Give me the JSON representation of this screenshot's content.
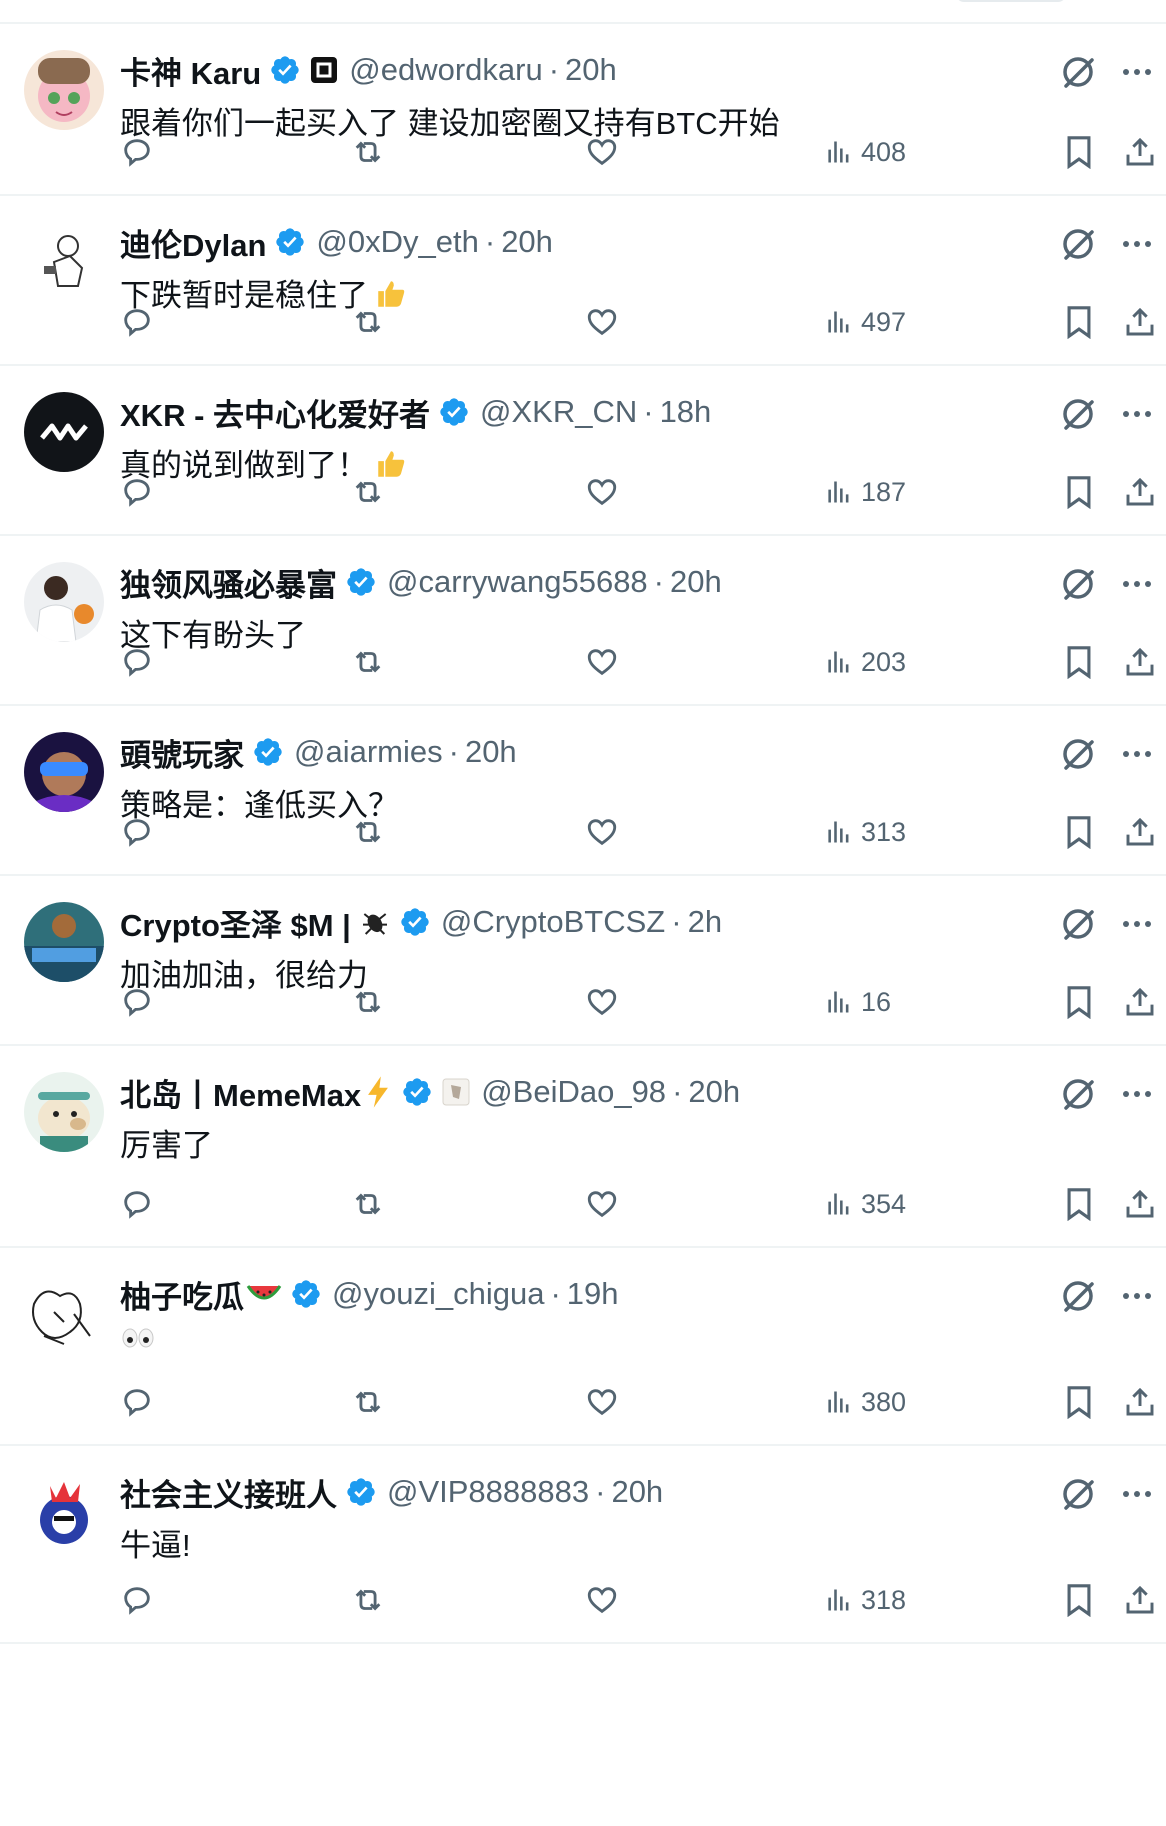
{
  "colors": {
    "verified": "#1d9bf0",
    "text": "#0f1419",
    "muted": "#536471",
    "divider": "#eff3f4"
  },
  "icons": {
    "reply": "reply-icon",
    "retweet": "retweet-icon",
    "like": "like-icon",
    "views": "views-icon",
    "bookmark": "bookmark-icon",
    "share": "share-icon",
    "grok": "grok-icon",
    "more": "more-icon",
    "verified": "verified-badge-icon"
  },
  "tweets": [
    {
      "name": "卡神 Karu",
      "handle": "@edwordkaru",
      "time": "20h",
      "text": "跟着你们一起买入了 建设加密圈又持有BTC开始",
      "views": "408"
    },
    {
      "name": "迪伦Dylan",
      "handle": "@0xDy_eth",
      "time": "20h",
      "text": "下跌暂时是稳住了",
      "views": "497"
    },
    {
      "name": "XKR - 去中心化爱好者",
      "handle": "@XKR_CN",
      "time": "18h",
      "text": "真的说到做到了！",
      "views": "187"
    },
    {
      "name": "独领风骚必暴富",
      "handle": "@carrywang55688",
      "time": "20h",
      "text": "这下有盼头了",
      "views": "203"
    },
    {
      "name": "頭號玩家",
      "handle": "@aiarmies",
      "time": "20h",
      "text": "策略是：逢低买入？",
      "views": "313"
    },
    {
      "name": "Crypto圣泽 $M |",
      "handle": "@CryptoBTCSZ",
      "time": "2h",
      "text": "加油加油，很给力",
      "views": "16"
    },
    {
      "name": "北岛丨MemeMax",
      "handle": "@BeiDao_98",
      "time": "20h",
      "text": "厉害了",
      "views": "354"
    },
    {
      "name": "柚子吃瓜",
      "handle": "@youzi_chigua",
      "time": "19h",
      "text": "",
      "views": "380"
    },
    {
      "name": "社会主义接班人",
      "handle": "@VIP8888883",
      "time": "20h",
      "text": "牛逼!",
      "views": "318"
    }
  ]
}
